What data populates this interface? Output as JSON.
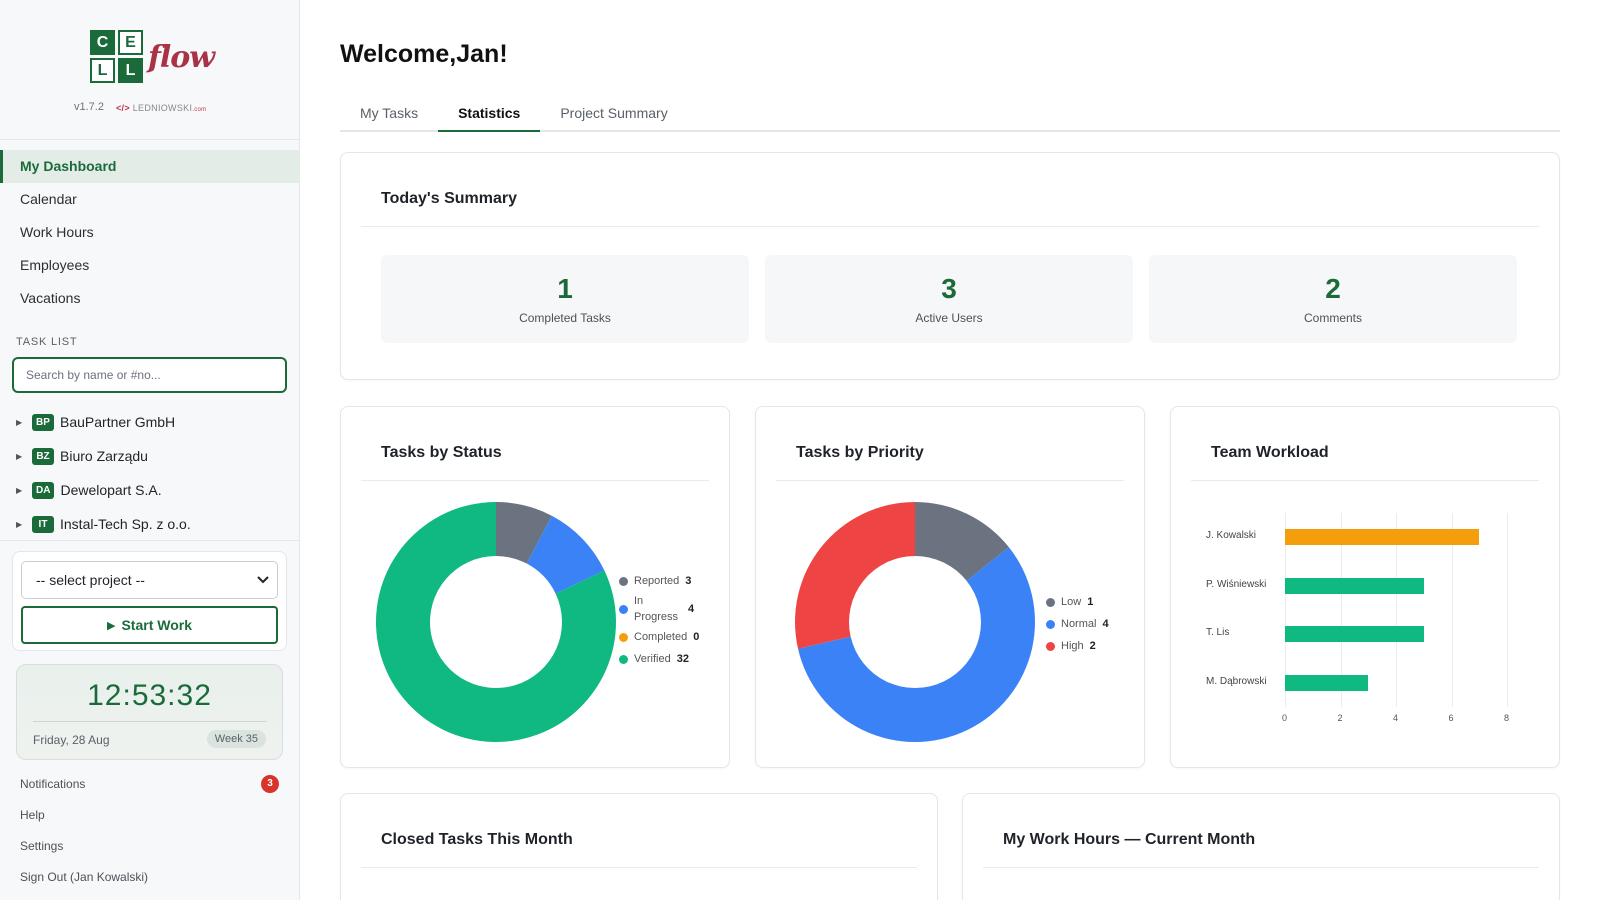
{
  "sidebar": {
    "logo": {
      "cells": [
        "C",
        "E",
        "L",
        "L"
      ],
      "suffix": "flow"
    },
    "version": "v1.7.2",
    "vendor_code": "</>",
    "vendor_name": "LEDNIOWSKI",
    "vendor_suffix": ".com",
    "nav": [
      {
        "label": "My Dashboard",
        "active": true
      },
      {
        "label": "Calendar"
      },
      {
        "label": "Work Hours"
      },
      {
        "label": "Employees"
      },
      {
        "label": "Vacations"
      }
    ],
    "task_list_label": "TASK LIST",
    "search_placeholder": "Search by name or #no...",
    "tree": [
      {
        "badge": "BP",
        "label": "BauPartner GmbH"
      },
      {
        "badge": "BZ",
        "label": "Biuro Zarządu"
      },
      {
        "badge": "DA",
        "label": "Dewelopart S.A."
      },
      {
        "badge": "IT",
        "label": "Instal-Tech Sp. z o.o."
      }
    ],
    "project_select": "-- select project --",
    "start_work": "Start Work",
    "clock": {
      "time": "12:53:32",
      "date": "Friday, 28 Aug",
      "week": "Week 35"
    },
    "links": [
      {
        "label": "Notifications",
        "badge": "3"
      },
      {
        "label": "Help"
      },
      {
        "label": "Settings"
      },
      {
        "label": "Sign Out (Jan Kowalski)"
      }
    ]
  },
  "main": {
    "welcome": "Welcome,Jan!",
    "tabs": [
      "My Tasks",
      "Statistics",
      "Project Summary"
    ],
    "active_tab": "Statistics",
    "summary": {
      "title": "Today's Summary",
      "tiles": [
        {
          "value": "1",
          "label": "Completed Tasks"
        },
        {
          "value": "3",
          "label": "Active Users"
        },
        {
          "value": "2",
          "label": "Comments"
        }
      ]
    },
    "cards": {
      "status_title": "Tasks by Status",
      "priority_title": "Tasks by Priority",
      "workload_title": "Team Workload",
      "closed_title": "Closed Tasks This Month",
      "hours_title": "My Work Hours — Current Month"
    }
  },
  "colors": {
    "brand": "#1b6b3a",
    "gray": "#6b7280",
    "blue": "#3b82f6",
    "amber": "#f59e0b",
    "green": "#10b981",
    "red": "#ef4444"
  },
  "chart_data": [
    {
      "type": "pie",
      "title": "Tasks by Status",
      "categories": [
        "Reported",
        "In Progress",
        "Completed",
        "Verified"
      ],
      "values": [
        3,
        4,
        0,
        32
      ],
      "colors": [
        "#6b7280",
        "#3b82f6",
        "#f59e0b",
        "#10b981"
      ],
      "legend": "right"
    },
    {
      "type": "pie",
      "title": "Tasks by Priority",
      "categories": [
        "Low",
        "Normal",
        "High"
      ],
      "values": [
        1,
        4,
        2
      ],
      "colors": [
        "#6b7280",
        "#3b82f6",
        "#ef4444"
      ],
      "legend": "right"
    },
    {
      "type": "bar",
      "title": "Team Workload",
      "orientation": "horizontal",
      "categories": [
        "J. Kowalski",
        "P. Wiśniewski",
        "T. Lis",
        "M. Dąbrowski"
      ],
      "values": [
        7,
        5,
        5,
        3
      ],
      "colors": [
        "#f59e0b",
        "#10b981",
        "#10b981",
        "#10b981"
      ],
      "xlim": [
        0,
        8
      ],
      "xticks": [
        0,
        2,
        4,
        6,
        8
      ],
      "grid": true
    }
  ]
}
